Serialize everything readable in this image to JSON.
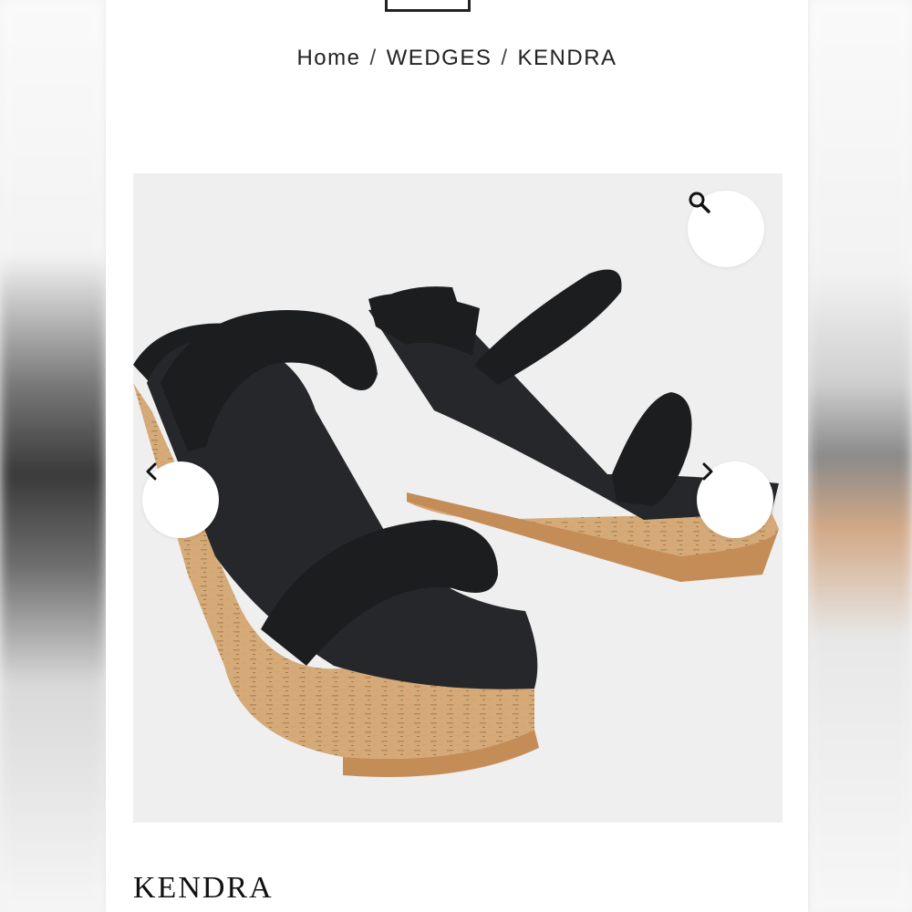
{
  "breadcrumb": {
    "home": "Home",
    "category": "WEDGES",
    "current": "KENDRA",
    "separator": "/"
  },
  "gallery": {
    "image_alt": "KENDRA",
    "zoom_icon": "search-icon",
    "prev_icon": "chevron-left-icon",
    "next_icon": "chevron-right-icon"
  },
  "product": {
    "title": "KENDRA"
  },
  "colors": {
    "strap": "#1c1d1f",
    "cork": "#d4aa78",
    "gallery_bg": "#efefef"
  }
}
